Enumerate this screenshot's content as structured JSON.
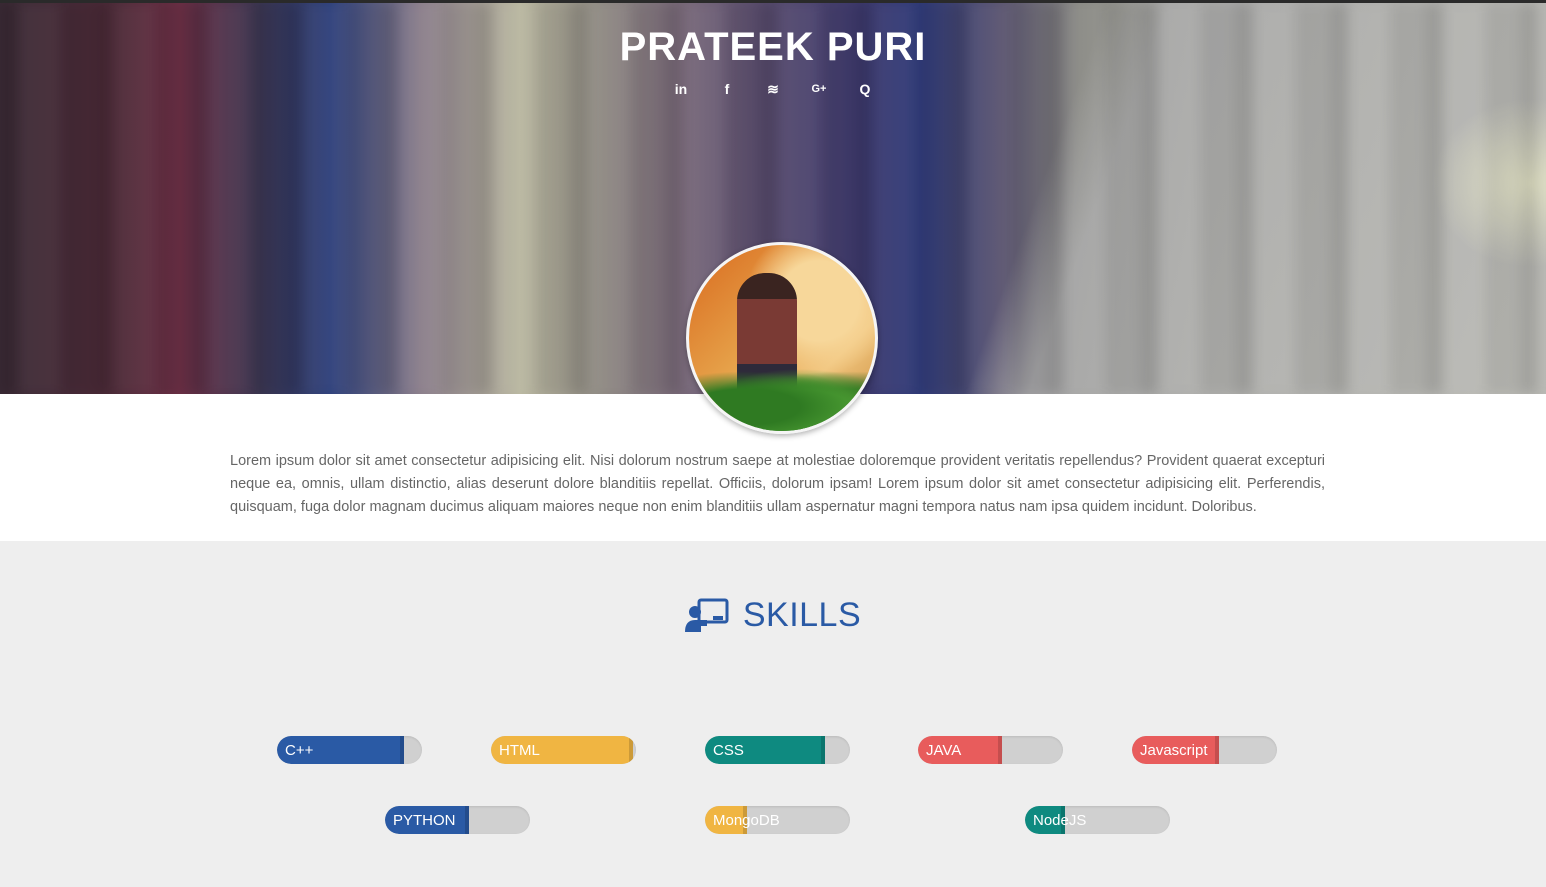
{
  "header": {
    "title": "PRATEEK PURI",
    "social": [
      "linkedin",
      "facebook",
      "stackoverflow",
      "google-plus",
      "quora"
    ],
    "social_glyphs": [
      "in",
      "f",
      "≋",
      "G+",
      "Q"
    ]
  },
  "about": {
    "text": "Lorem ipsum dolor sit amet consectetur adipisicing elit. Nisi dolorum nostrum saepe at molestiae doloremque provident veritatis repellendus? Provident quaerat excepturi neque ea, omnis, ullam distinctio, alias deserunt dolore blanditiis repellat. Officiis, dolorum ipsam! Lorem ipsum dolor sit amet consectetur adipisicing elit. Perferendis, quisquam, fuga dolor magnam ducimus aliquam maiores neque non enim blanditiis ullam aspernatur magni tempora natus nam ipsa quidem incidunt. Doloribus."
  },
  "skills": {
    "title": "SKILLS",
    "items": [
      {
        "name": "C++",
        "level": 0.85,
        "color": "#2a5aa5"
      },
      {
        "name": "HTML",
        "level": 0.95,
        "color": "#f0b542"
      },
      {
        "name": "CSS",
        "level": 0.8,
        "color": "#0e8a80"
      },
      {
        "name": "JAVA",
        "level": 0.55,
        "color": "#e85c5c"
      },
      {
        "name": "Javascript",
        "level": 0.57,
        "color": "#e85c5c"
      },
      {
        "name": "PYTHON",
        "level": 0.55,
        "color": "#2a5aa5"
      },
      {
        "name": "MongoDB",
        "level": 0.26,
        "color": "#f0b542"
      },
      {
        "name": "NodeJS",
        "level": 0.25,
        "color": "#0e8a80"
      }
    ]
  }
}
